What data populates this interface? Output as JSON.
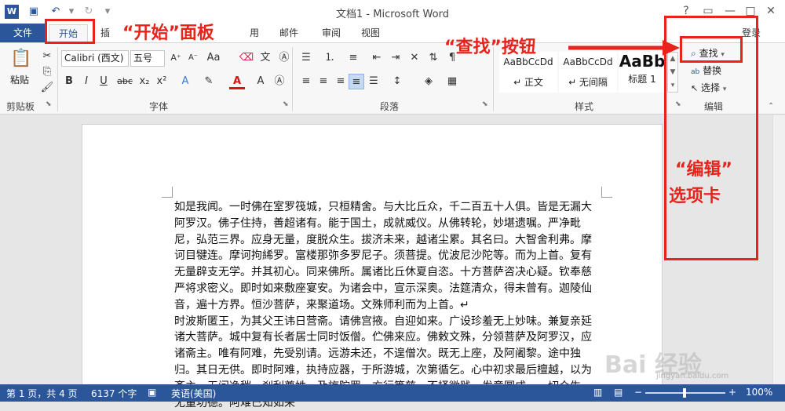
{
  "window": {
    "title": "文档1 - Microsoft Word",
    "help": "?",
    "controls": [
      "—",
      "□",
      "✕"
    ],
    "user": "登录"
  },
  "tabs": {
    "file": "文件",
    "home": "开始",
    "insert": "插",
    "others": [
      "用",
      "邮件",
      "审阅",
      "视图"
    ]
  },
  "ribbon": {
    "clipboard": {
      "paste": "粘贴",
      "label": "剪贴板"
    },
    "font": {
      "family": "Calibri (西文)",
      "size": "五号",
      "label": "字体",
      "bold": "B",
      "italic": "I",
      "underline": "U",
      "strike": "abc",
      "sub": "x₂",
      "sup": "x²",
      "font_color": "A"
    },
    "paragraph": {
      "label": "段落"
    },
    "styles": {
      "label": "样式",
      "items": [
        {
          "preview": "AaBbCcDd",
          "name": "↵ 正文"
        },
        {
          "preview": "AaBbCcDd",
          "name": "↵ 无间隔"
        },
        {
          "preview": "AaBb",
          "name": "标题 1"
        }
      ]
    },
    "editing": {
      "find": "查找",
      "replace": "替换",
      "select": "选择",
      "label": "编辑"
    }
  },
  "annotations": {
    "home_panel": "“开始”面板",
    "find_button": "“查找”按钮",
    "edit_tab_line1": "“编辑”",
    "edit_tab_line2": "选项卡"
  },
  "document": {
    "text": "如是我闻。一时佛在室罗筏城，只桓精舍。与大比丘众，千二百五十人俱。皆是无漏大阿罗汉。佛子住持，善超诸有。能于国土，成就威仪。从佛转轮，妙堪遗嘱。严净毗尼，弘范三界。应身无量，度脱众生。拔济未来，越诸尘累。其名曰。大智舍利弗。摩诃目犍连。摩诃拘絺罗。富楼那弥多罗尼子。须菩提。优波尼沙陀等。而为上首。复有无量辟支无学。并其初心。同来佛所。属诸比丘休夏自恣。十方菩萨咨决心疑。钦奉慈严将求密义。即时如来敷座宴安。为诸会中，宣示深奥。法筵清众，得未曾有。迦陵仙音，遍十方界。恒沙菩萨，来聚道场。文殊师利而为上首。↵\n时波斯匿王，为其父王讳日营斋。请佛宫掖。自迎如来。广设珍羞无上妙味。兼复亲延诸大菩萨。城中复有长者居士同时饭僧。伫佛来应。佛敕文殊，分领菩萨及阿罗汉，应诸斋主。唯有阿难，先受别请。远游未还，不遑僧次。既无上座，及阿阇黎。途中独归。其日无供。即时阿难，执持应器，于所游城，次第循乞。心中初求最后檀越，以为斋主。无问净秽，刹利尊姓，及旃陀罗。方行等慈，不择微贱。发意圆成，一切众生，无量功德。阿难已知如来"
  },
  "status": {
    "page": "第 1 页，共 4 页",
    "words": "6137 个字",
    "language": "英语(美国)",
    "zoom": "100%"
  },
  "watermark": {
    "brand": "Bai 经验",
    "url": "jingyan.baidu.com"
  },
  "colors": {
    "accent": "#2b579a",
    "annotation": "#e8231b"
  }
}
